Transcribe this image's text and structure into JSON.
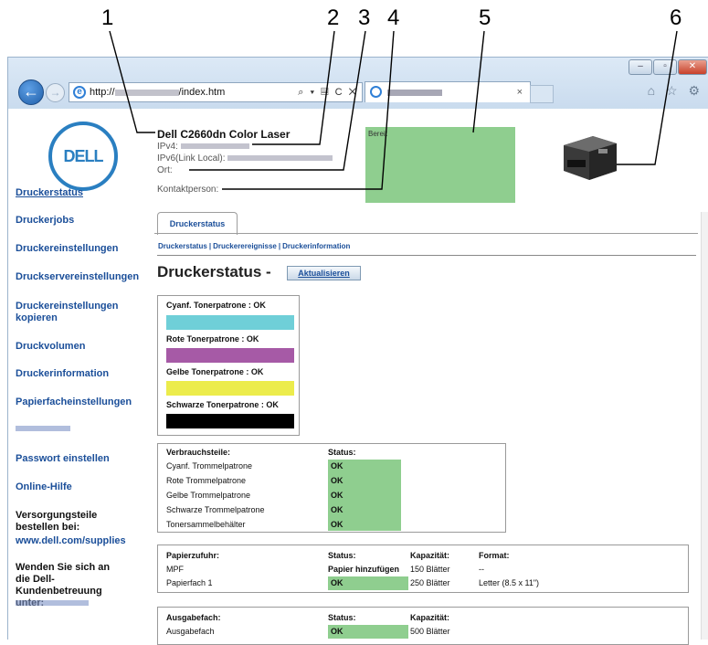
{
  "callouts": {
    "n1": "1",
    "n2": "2",
    "n3": "3",
    "n4": "4",
    "n5": "5",
    "n6": "6"
  },
  "browser": {
    "address_prefix": "http://",
    "address_suffix": "/index.htm",
    "address_controls": "⌕ ▾ ▤ C ✕",
    "tab_close": "×",
    "back_glyph": "←",
    "forward_glyph": "→",
    "right_icons": "⌂ ☆ ⚙",
    "window_buttons": {
      "minimize": "–",
      "maximize": "▫",
      "close": "✕"
    }
  },
  "logo_text": "DELL",
  "printer": {
    "model": "Dell C2660dn Color Laser",
    "ipv4_label": "IPv4:",
    "ipv6_label": "IPv6(Link Local):",
    "location_label": "Ort:",
    "contact_label": "Kontaktperson:",
    "status_text": "Bereit"
  },
  "sidebar": {
    "items": [
      "Druckerstatus",
      "Druckerjobs",
      "Druckereinstellungen",
      "Druckservereinstellungen",
      "Druckereinstellungen kopieren",
      "Druckvolumen",
      "Druckerinformation",
      "Papierfacheinstellungen",
      "Passwort einstellen",
      "Online-Hilfe"
    ],
    "supplies_text": "Versorgungsteile bestellen bei:",
    "supplies_link": "www.dell.com/supplies",
    "support_text": "Wenden Sie sich an die Dell-Kundenbetreuung unter:"
  },
  "main": {
    "tab_label": "Druckerstatus",
    "sublinks": [
      "Druckerstatus",
      "Druckerereignisse",
      "Druckerinformation"
    ],
    "sublink_sep": "|",
    "heading": "Druckerstatus -",
    "refresh_button": "Aktualisieren",
    "toners": [
      {
        "label": "Cyanf. Tonerpatrone : OK",
        "color": "#6fcfd8"
      },
      {
        "label": "Rote Tonerpatrone : OK",
        "color": "#a65aa6"
      },
      {
        "label": "Gelbe Tonerpatrone : OK",
        "color": "#ecec4c"
      },
      {
        "label": "Schwarze Tonerpatrone : OK",
        "color": "#000000"
      }
    ],
    "consumables": {
      "header": "Verbrauchsteile:",
      "status_header": "Status:",
      "rows": [
        {
          "name": "Cyanf. Trommelpatrone",
          "status": "OK"
        },
        {
          "name": "Rote Trommelpatrone",
          "status": "OK"
        },
        {
          "name": "Gelbe Trommelpatrone",
          "status": "OK"
        },
        {
          "name": "Schwarze Trommelpatrone",
          "status": "OK"
        },
        {
          "name": "Tonersammelbehälter",
          "status": "OK"
        }
      ]
    },
    "paper_input": {
      "headers": [
        "Papierzufuhr:",
        "Status:",
        "Kapazität:",
        "Format:"
      ],
      "rows": [
        {
          "name": "MPF",
          "status": "Papier hinzufügen",
          "capacity": "150 Blätter",
          "format": "--"
        },
        {
          "name": "Papierfach 1",
          "status": "OK",
          "capacity": "250 Blätter",
          "format": "Letter (8.5 x 11\")"
        }
      ]
    },
    "output": {
      "headers": [
        "Ausgabefach:",
        "Status:",
        "Kapazität:"
      ],
      "rows": [
        {
          "name": "Ausgabefach",
          "status": "OK",
          "capacity": "500 Blätter"
        }
      ]
    }
  },
  "colors": {
    "ok_green": "#8fce8f",
    "link_blue": "#1a4e99",
    "dell_blue": "#2a7fc1"
  }
}
